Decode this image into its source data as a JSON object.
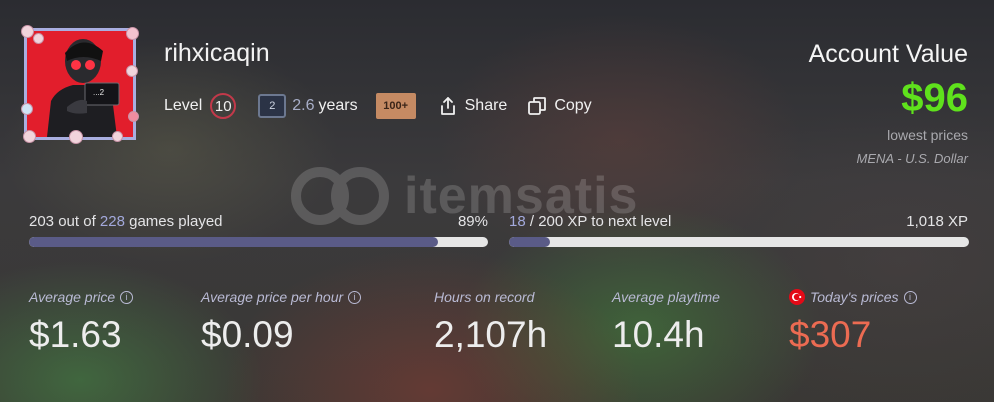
{
  "watermark": {
    "brand": "itemsatis"
  },
  "profile": {
    "username": "rihxicaqin",
    "avatar_text": "...2",
    "level_label": "Level",
    "level": "10",
    "years_badge": "2",
    "years": "2.6",
    "years_unit": "years",
    "games_badge": "100+",
    "share_label": "Share",
    "copy_label": "Copy"
  },
  "account": {
    "title": "Account Value",
    "value": "$96",
    "note": "lowest prices",
    "region": "MENA - U.S. Dollar"
  },
  "games_progress": {
    "played": "203",
    "out_of_text": "out of",
    "total": "228",
    "suffix_text": "games played",
    "percent": "89%",
    "fraction": 0.89
  },
  "xp_progress": {
    "current": "18",
    "separator": "/ 200 XP to next level",
    "total_xp": "1,018 XP",
    "fraction": 0.09
  },
  "stats": [
    {
      "label": "Average price",
      "value": "$1.63"
    },
    {
      "label": "Average price per hour",
      "value": "$0.09"
    },
    {
      "label": "Hours on record",
      "value": "2,107h"
    },
    {
      "label": "Average playtime",
      "value": "10.4h"
    },
    {
      "label": "Today's prices",
      "value": "$307"
    }
  ],
  "colors": {
    "accent_green": "#5fe21c",
    "today_price": "#ec6b52",
    "progress_fill": "#5a5b87",
    "level_ring": "#c2394a"
  }
}
